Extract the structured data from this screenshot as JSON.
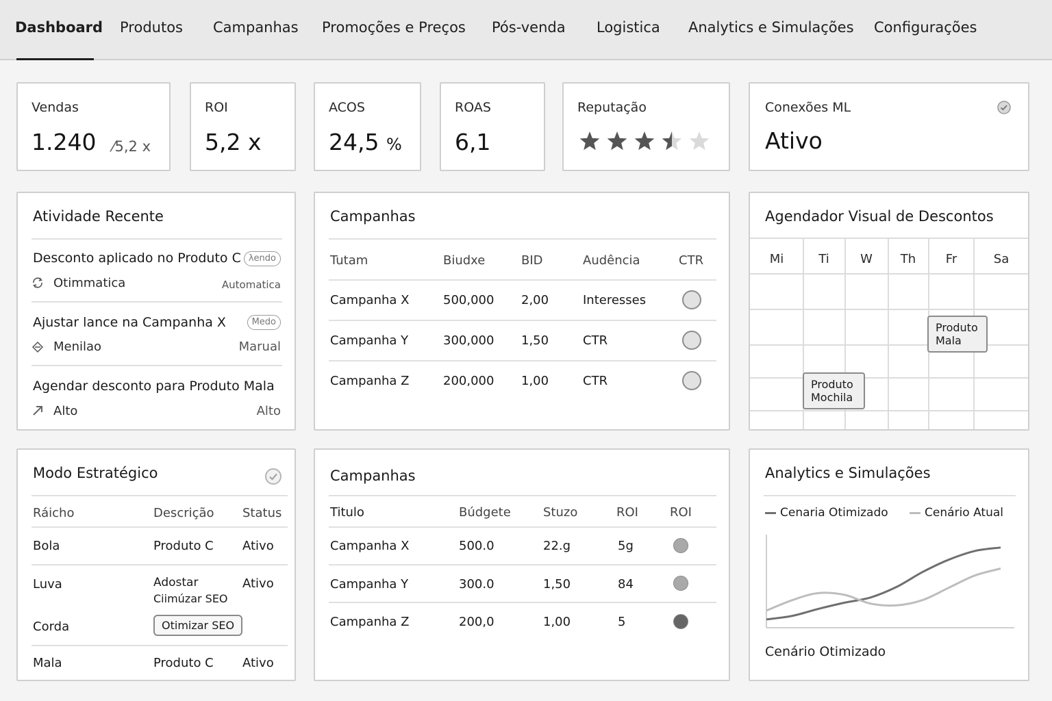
{
  "nav": {
    "tabs": [
      {
        "label": "Dashboard",
        "active": true
      },
      {
        "label": "Produtos"
      },
      {
        "label": "Campanhas"
      },
      {
        "label": "Promoções e Preços"
      },
      {
        "label": "Pós-venda"
      },
      {
        "label": "Logistica"
      },
      {
        "label": "Analytics e Simulações"
      },
      {
        "label": "Configurações"
      }
    ]
  },
  "kpis": {
    "vendas": {
      "label": "Vendas",
      "value": "1.240",
      "sub": "⁄5,2 x"
    },
    "roi": {
      "label": "ROI",
      "value": "5,2 x"
    },
    "acos": {
      "label": "ACOS",
      "value": "24,5",
      "unit": "%"
    },
    "roas": {
      "label": "ROAS",
      "value": "6,1"
    },
    "reputacao": {
      "label": "Reputação",
      "rating": 3.5,
      "max": 5
    },
    "conexoes": {
      "label": "Conexões ML",
      "value": "Ativo",
      "icon": "check-circle-icon"
    }
  },
  "activity": {
    "title": "Atividade Recente",
    "items": [
      {
        "title": "Desconto aplicado no Produto C",
        "pill": "λendo",
        "sub": "Otimmatica",
        "right": "Automatica",
        "icon": "sync-icon"
      },
      {
        "title": "Ajustar lance na Campanha X",
        "pill": "Medo",
        "sub": "Menilao",
        "right": "Marual",
        "icon": "diamond-arrows-icon"
      },
      {
        "title": "Agendar desconto para Produto Mala",
        "sub": "Alto",
        "right": "Alto",
        "icon": "arrow-up-right-icon"
      }
    ]
  },
  "campaigns1": {
    "title": "Campanhas",
    "headers": [
      "Tutam",
      "Biudxe",
      "BID",
      "Audência",
      "CTR"
    ],
    "rows": [
      [
        "Campanha X",
        "500,000",
        "2,00",
        "Interesses"
      ],
      [
        "Campanha Y",
        "300,000",
        "1,50",
        "CTR"
      ],
      [
        "Campanha Z",
        "200,000",
        "1,00",
        "CTR"
      ]
    ]
  },
  "scheduler": {
    "title": "Agendador Visual de Descontos",
    "days": [
      "Mi",
      "Ti",
      "W",
      "Th",
      "Fr",
      "Sa"
    ],
    "events": [
      {
        "label_line1": "Produto",
        "label_line2": "Mala",
        "day": "Fr"
      },
      {
        "label_line1": "Produto",
        "label_line2": "Mochila",
        "day": "Ti"
      }
    ]
  },
  "strategic": {
    "title": "Modo Estratégico",
    "headers": [
      "Ráicho",
      "Descrição",
      "Status"
    ],
    "rows": [
      {
        "name": "Bola",
        "desc": "Produto C",
        "status": "Ativo"
      },
      {
        "name": "Luva",
        "desc": "Adostar",
        "desc2": "Ciimúzar SEO",
        "status": "Ativo"
      },
      {
        "name": "Corda",
        "button": "Otimizar SEO"
      },
      {
        "name": "Mala",
        "desc": "Produto C",
        "status": "Ativo"
      }
    ]
  },
  "campaigns2": {
    "title": "Campanhas",
    "headers": [
      "Titulo",
      "Búdgete",
      "Stuzo",
      "ROI",
      "ROI"
    ],
    "rows": [
      [
        "Campanha X",
        "500.0",
        "22.g",
        "5g"
      ],
      [
        "Campanha Y",
        "300.0",
        "1,50",
        "84"
      ],
      [
        "Campanha Z",
        "200,0",
        "1,00",
        "5"
      ]
    ],
    "dot_colors": [
      "#a9a9a9",
      "#a9a9a9",
      "#666666"
    ]
  },
  "analytics": {
    "title": "Analytics e Simulações",
    "footer": "Cenário Otimizado",
    "chart_data": {
      "type": "line",
      "series": [
        {
          "name": "Cenaria Otimizado",
          "color": "#6f6f6f",
          "values": [
            0.08,
            0.12,
            0.2,
            0.27,
            0.33,
            0.45,
            0.62,
            0.76,
            0.86,
            0.9
          ]
        },
        {
          "name": "Cenário Atual",
          "color": "#bdbdbd",
          "values": [
            0.18,
            0.3,
            0.38,
            0.36,
            0.26,
            0.24,
            0.3,
            0.44,
            0.58,
            0.66
          ]
        }
      ]
    }
  }
}
